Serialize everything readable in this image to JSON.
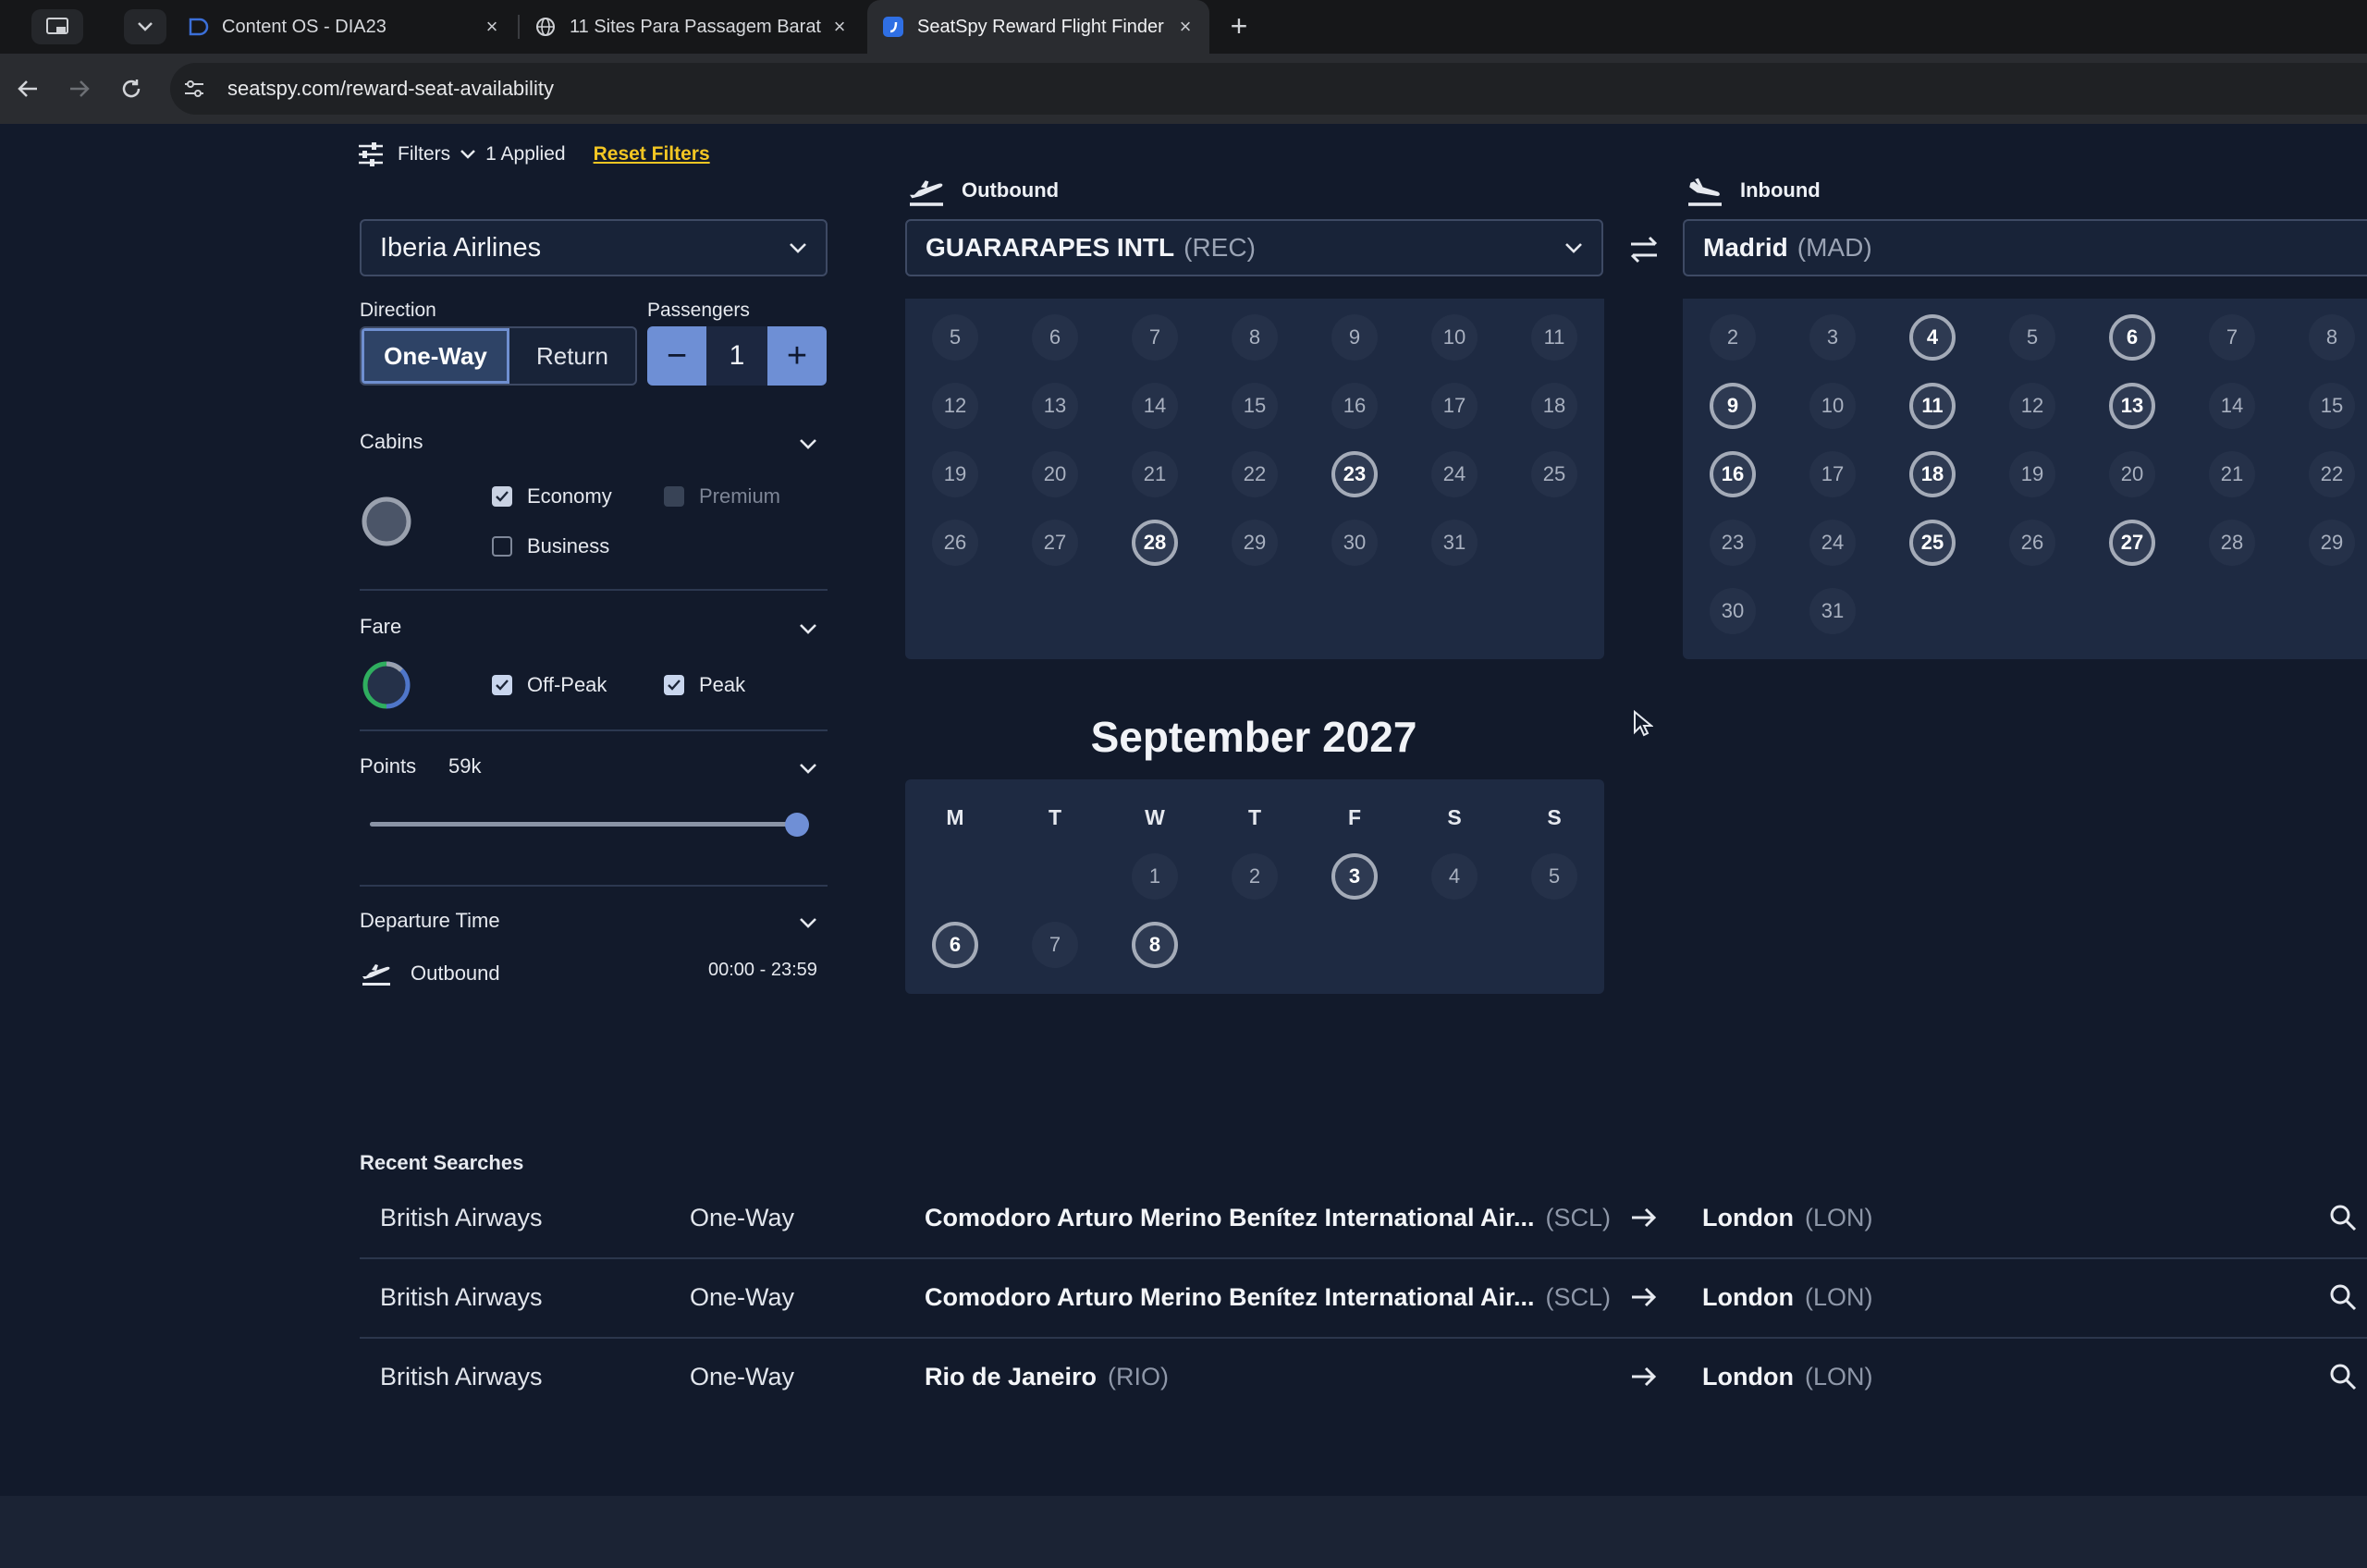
{
  "browser": {
    "tabs": [
      {
        "title": "Content OS - DIA23",
        "close": "×"
      },
      {
        "title": "11 Sites Para Passagem Barat",
        "close": "×"
      },
      {
        "title": "SeatSpy Reward Flight Finder",
        "close": "×"
      }
    ],
    "new_tab": "+",
    "url": "seatspy.com/reward-seat-availability"
  },
  "filters": {
    "label": "Filters",
    "applied": "1 Applied",
    "reset": "Reset Filters",
    "airline": "Iberia Airlines",
    "direction_label": "Direction",
    "direction_options": [
      "One-Way",
      "Return"
    ],
    "direction_selected": "One-Way",
    "passengers_label": "Passengers",
    "passengers": "1",
    "minus": "−",
    "plus": "+",
    "cabins": {
      "title": "Cabins",
      "economy": "Economy",
      "premium": "Premium",
      "business": "Business",
      "economy_checked": true,
      "business_checked": false,
      "premium_disabled": true
    },
    "fare": {
      "title": "Fare",
      "off_peak": "Off-Peak",
      "peak": "Peak",
      "off_peak_checked": true,
      "peak_checked": true
    },
    "points": {
      "title": "Points",
      "value": "59k",
      "slider_fraction": 1.0
    },
    "departure_time": {
      "title": "Departure Time",
      "outbound_label": "Outbound",
      "range": "00:00 - 23:59"
    }
  },
  "outbound": {
    "label": "Outbound",
    "airport_name": "GUARARAPES INTL",
    "airport_code": "(REC)",
    "august_days": [
      5,
      6,
      7,
      8,
      9,
      10,
      11,
      12,
      13,
      14,
      15,
      16,
      17,
      18,
      19,
      20,
      21,
      22,
      23,
      24,
      25,
      26,
      27,
      28,
      29,
      30,
      31
    ],
    "august_available": [
      23,
      28
    ],
    "september": {
      "title": "September 2027",
      "weekdays": [
        "M",
        "T",
        "W",
        "T",
        "F",
        "S",
        "S"
      ],
      "days": [
        1,
        2,
        3,
        4,
        5,
        6,
        7,
        8
      ],
      "available": [
        3,
        6,
        8
      ]
    }
  },
  "inbound": {
    "label": "Inbound",
    "airport_name": "Madrid",
    "airport_code": "(MAD)",
    "days": [
      2,
      3,
      4,
      5,
      6,
      7,
      8,
      9,
      10,
      11,
      12,
      13,
      14,
      15,
      16,
      17,
      18,
      19,
      20,
      21,
      22,
      23,
      24,
      25,
      26,
      27,
      28,
      29,
      30,
      31
    ],
    "available": [
      4,
      6,
      9,
      11,
      13,
      16,
      18,
      25,
      27
    ]
  },
  "recent_searches": {
    "title": "Recent Searches",
    "rows": [
      {
        "airline": "British Airways",
        "type": "One-Way",
        "from_name": "Comodoro Arturo Merino Benítez International Air...",
        "from_code": "(SCL)",
        "to_name": "London",
        "to_code": "(LON)"
      },
      {
        "airline": "British Airways",
        "type": "One-Way",
        "from_name": "Comodoro Arturo Merino Benítez International Air...",
        "from_code": "(SCL)",
        "to_name": "London",
        "to_code": "(LON)"
      },
      {
        "airline": "British Airways",
        "type": "One-Way",
        "from_name": "Rio de Janeiro",
        "from_code": "(RIO)",
        "to_name": "London",
        "to_code": "(LON)"
      }
    ]
  },
  "colors": {
    "background": "#121a2b",
    "accent": "#6f8fd6",
    "reset_link": "#f3c623",
    "panel": "#1e2a42"
  }
}
